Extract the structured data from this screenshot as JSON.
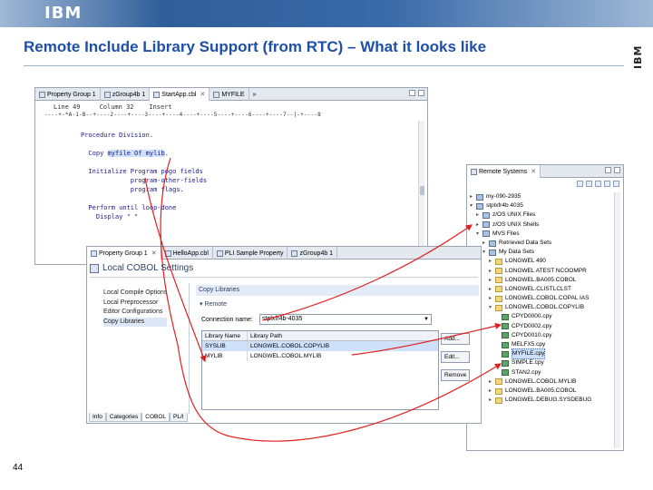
{
  "slide": {
    "logo": "IBM",
    "title": "Remote Include Library Support (from RTC) – What it looks like",
    "page_number": "44"
  },
  "editor": {
    "tabs": [
      "Property Group 1",
      "zGroup4b 1",
      "StartApp.cbl",
      "MYFILE"
    ],
    "status_line": "Line 49     Column 32    Insert",
    "ruler": "----+-*A-1-B--+----2----+----3----+----4----+----5----+----6----+----7--|-+----8",
    "code_lines": [
      {
        "pre": "Procedure Division.",
        "hl": "",
        "post": ""
      },
      {
        "pre": "",
        "hl": "",
        "post": ""
      },
      {
        "pre": "  Copy ",
        "hl": "myfile Of mylib",
        "post": "."
      },
      {
        "pre": "",
        "hl": "",
        "post": ""
      },
      {
        "pre": "  Initialize Program pogo fields",
        "hl": "",
        "post": ""
      },
      {
        "pre": "             program-other-fields",
        "hl": "",
        "post": ""
      },
      {
        "pre": "             program flags.",
        "hl": "",
        "post": ""
      },
      {
        "pre": "",
        "hl": "",
        "post": ""
      },
      {
        "pre": "  Perform until loop-done",
        "hl": "",
        "post": ""
      },
      {
        "pre": "    Display \" \"",
        "hl": "",
        "post": ""
      }
    ]
  },
  "remote": {
    "tab": "Remote Systems",
    "tree": [
      {
        "indent": 0,
        "twisty": "▸",
        "icon": "sys",
        "label": "my-090-2935"
      },
      {
        "indent": 0,
        "twisty": "▾",
        "icon": "sys",
        "label": "stplxfr4b 4035"
      },
      {
        "indent": 1,
        "twisty": "▸",
        "icon": "sys",
        "label": "z/OS UNIX Files"
      },
      {
        "indent": 1,
        "twisty": "▸",
        "icon": "sys",
        "label": "z/OS UNIX Shells"
      },
      {
        "indent": 1,
        "twisty": "▾",
        "icon": "sys",
        "label": "MVS Files"
      },
      {
        "indent": 2,
        "twisty": "▸",
        "icon": "sys",
        "label": "Retrieved Data Sets"
      },
      {
        "indent": 2,
        "twisty": "▾",
        "icon": "sys",
        "label": "My Data Sets"
      },
      {
        "indent": 3,
        "twisty": "▸",
        "icon": "folder",
        "label": "LONGWEL 490"
      },
      {
        "indent": 3,
        "twisty": "▸",
        "icon": "folder",
        "label": "LONGWEL ATEST NCOOMPR"
      },
      {
        "indent": 3,
        "twisty": "▸",
        "icon": "folder",
        "label": "LONGWEL.BA005.COBOL"
      },
      {
        "indent": 3,
        "twisty": "▸",
        "icon": "folder",
        "label": "LONGWEL.CLISTLCLST"
      },
      {
        "indent": 3,
        "twisty": "▸",
        "icon": "folder",
        "label": "LONGWEL.COBOL.COPAL IAS"
      },
      {
        "indent": 3,
        "twisty": "▾",
        "icon": "folder",
        "label": "LONGWEL.COBOL.COPYLIB"
      },
      {
        "indent": 4,
        "twisty": "",
        "icon": "file",
        "label": "CPYD0000.cpy"
      },
      {
        "indent": 4,
        "twisty": "",
        "icon": "file",
        "label": "CPYD0002.cpy"
      },
      {
        "indent": 4,
        "twisty": "",
        "icon": "file",
        "label": "CPYD0010.cpy"
      },
      {
        "indent": 4,
        "twisty": "",
        "icon": "file",
        "label": "MELFX5.cpy"
      },
      {
        "indent": 4,
        "twisty": "",
        "icon": "file",
        "label": "MYFILE.cpy",
        "selected": true
      },
      {
        "indent": 4,
        "twisty": "",
        "icon": "file",
        "label": "SIMPLE.cpy"
      },
      {
        "indent": 4,
        "twisty": "",
        "icon": "file",
        "label": "STAN2.cpy"
      },
      {
        "indent": 3,
        "twisty": "▸",
        "icon": "folder",
        "label": "LONGWEL.COBOL.MYLIB"
      },
      {
        "indent": 3,
        "twisty": "▸",
        "icon": "folder",
        "label": "LONGWEL.BA005.COBOL"
      },
      {
        "indent": 3,
        "twisty": "▸",
        "icon": "folder",
        "label": "LONGWEL.DEBUG.SYSDEBUG"
      }
    ]
  },
  "props": {
    "tabs": [
      "Property Group 1",
      "HelloApp.cbl",
      "PLI Sample Property",
      "zGroup4b 1"
    ],
    "header": "Local COBOL Settings",
    "nav": [
      "Local Compile Options",
      "Local Preprocessor",
      "Editor Configurations",
      "Copy Libraries"
    ],
    "nav_active": 3,
    "section": "Copy Libraries",
    "remote_label": "Remote",
    "connection_label": "Connection name:",
    "connection_value": "stplxfr4b-4035",
    "table_headers": [
      "Library Name",
      "Library Path"
    ],
    "table_rows": [
      {
        "name": "SYSLIB",
        "path": "LONGWEL.COBOL.COPYLIB",
        "selected": true
      },
      {
        "name": "MYLIB",
        "path": "LONGWEL.COBOL.MYLIB",
        "selected": false
      }
    ],
    "buttons": [
      "Add...",
      "Edit...",
      "Remove"
    ],
    "bottom_tabs": [
      "Info",
      "Categories",
      "COBOL",
      "PL/I"
    ],
    "bottom_active": 2
  },
  "colors": {
    "title": "#1f50a8",
    "arrow": "#e02020"
  }
}
